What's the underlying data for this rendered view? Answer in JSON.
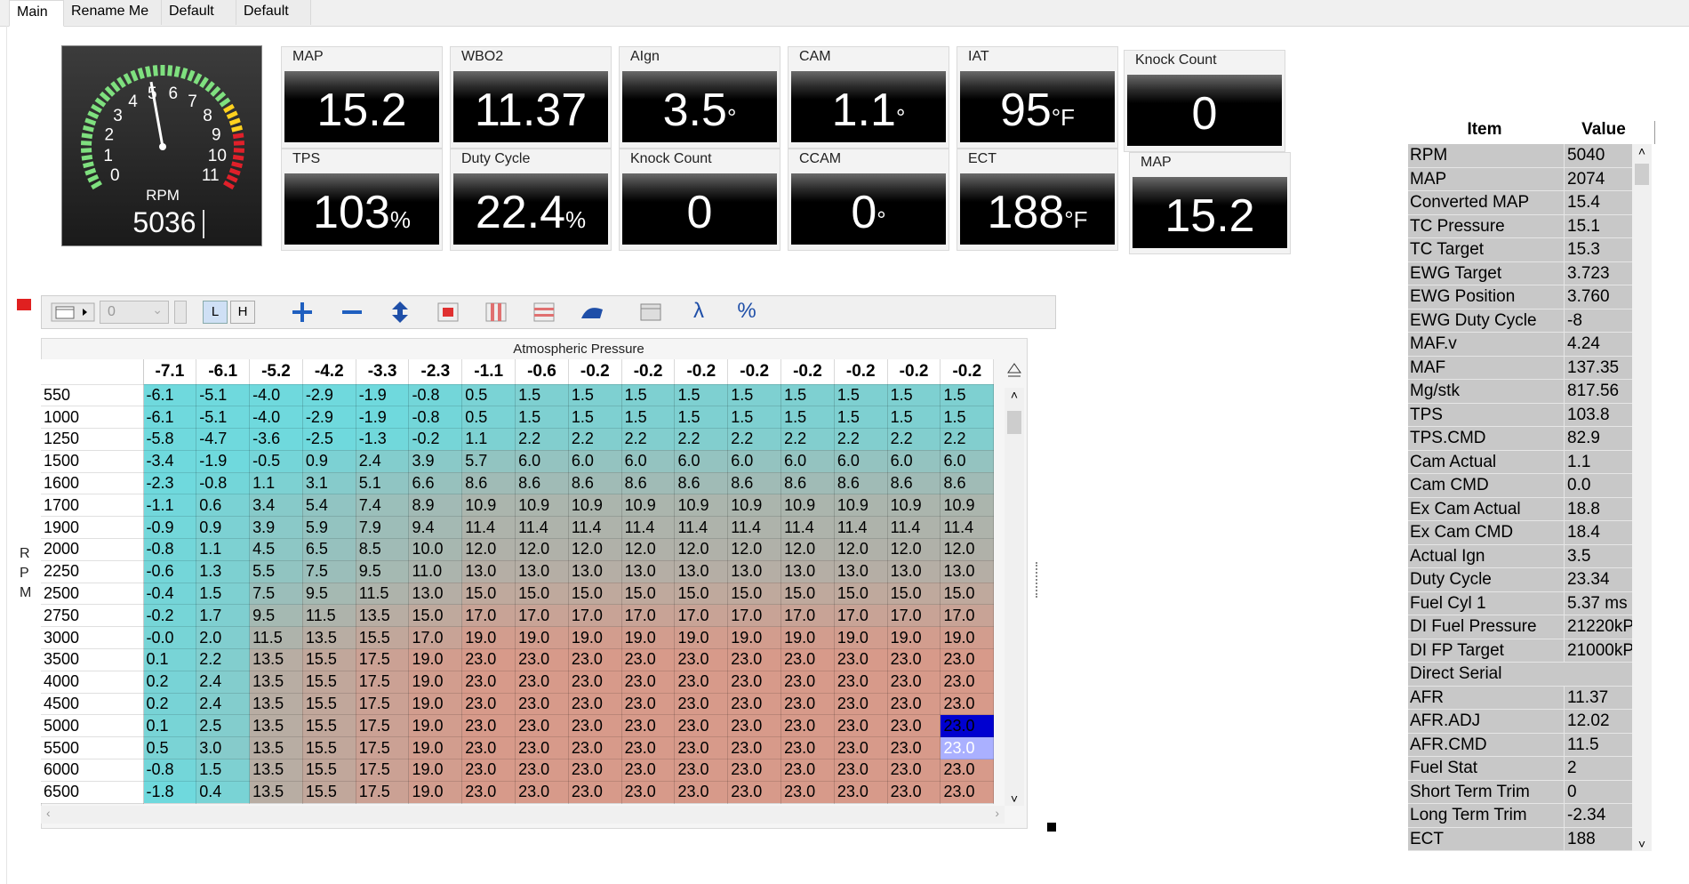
{
  "tabs": [
    "Main",
    "Rename Me",
    "Default",
    "Default"
  ],
  "gauge": {
    "label": "RPM",
    "value": "5036",
    "ticks": [
      "0",
      "1",
      "2",
      "3",
      "4",
      "5",
      "6",
      "7",
      "8",
      "9",
      "10",
      "11"
    ]
  },
  "tiles": [
    {
      "label": "MAP",
      "value": "15.2",
      "unit": ""
    },
    {
      "label": "WBO2",
      "value": "11.37",
      "unit": ""
    },
    {
      "label": "AIgn",
      "value": "3.5",
      "unit": "°"
    },
    {
      "label": "CAM",
      "value": "1.1",
      "unit": "°"
    },
    {
      "label": "IAT",
      "value": "95",
      "unit": "°F"
    },
    {
      "label": "Knock Count",
      "value": "0",
      "unit": ""
    },
    {
      "label": "TPS",
      "value": "103",
      "unit": "%"
    },
    {
      "label": "Duty Cycle",
      "value": "22.4",
      "unit": "%"
    },
    {
      "label": "Knock Count",
      "value": "0",
      "unit": ""
    },
    {
      "label": "CCAM",
      "value": "0",
      "unit": "°"
    },
    {
      "label": "ECT",
      "value": "188",
      "unit": "°F"
    },
    {
      "label": "MAP",
      "value": "15.2",
      "unit": ""
    }
  ],
  "toolbar": {
    "index_value": "0",
    "low_label": "L",
    "high_label": "H",
    "lambda_label": "λ",
    "percent_label": "%"
  },
  "table": {
    "x_axis_title": "Atmospheric Pressure",
    "y_axis_title": "RPM",
    "columns": [
      "-7.1",
      "-6.1",
      "-5.2",
      "-4.2",
      "-3.3",
      "-2.3",
      "-1.1",
      "-0.6",
      "-0.2",
      "-0.2",
      "-0.2",
      "-0.2",
      "-0.2",
      "-0.2",
      "-0.2",
      "-0.2"
    ],
    "rows": [
      {
        "rpm": "550",
        "values": [
          "-6.1",
          "-5.1",
          "-4.0",
          "-2.9",
          "-1.9",
          "-0.8",
          "0.5",
          "1.5",
          "1.5",
          "1.5",
          "1.5",
          "1.5",
          "1.5",
          "1.5",
          "1.5",
          "1.5"
        ]
      },
      {
        "rpm": "1000",
        "values": [
          "-6.1",
          "-5.1",
          "-4.0",
          "-2.9",
          "-1.9",
          "-0.8",
          "0.5",
          "1.5",
          "1.5",
          "1.5",
          "1.5",
          "1.5",
          "1.5",
          "1.5",
          "1.5",
          "1.5"
        ]
      },
      {
        "rpm": "1250",
        "values": [
          "-5.8",
          "-4.7",
          "-3.6",
          "-2.5",
          "-1.3",
          "-0.2",
          "1.1",
          "2.2",
          "2.2",
          "2.2",
          "2.2",
          "2.2",
          "2.2",
          "2.2",
          "2.2",
          "2.2"
        ]
      },
      {
        "rpm": "1500",
        "values": [
          "-3.4",
          "-1.9",
          "-0.5",
          "0.9",
          "2.4",
          "3.9",
          "5.7",
          "6.0",
          "6.0",
          "6.0",
          "6.0",
          "6.0",
          "6.0",
          "6.0",
          "6.0",
          "6.0"
        ]
      },
      {
        "rpm": "1600",
        "values": [
          "-2.3",
          "-0.8",
          "1.1",
          "3.1",
          "5.1",
          "6.6",
          "8.6",
          "8.6",
          "8.6",
          "8.6",
          "8.6",
          "8.6",
          "8.6",
          "8.6",
          "8.6",
          "8.6"
        ]
      },
      {
        "rpm": "1700",
        "values": [
          "-1.1",
          "0.6",
          "3.4",
          "5.4",
          "7.4",
          "8.9",
          "10.9",
          "10.9",
          "10.9",
          "10.9",
          "10.9",
          "10.9",
          "10.9",
          "10.9",
          "10.9",
          "10.9"
        ]
      },
      {
        "rpm": "1900",
        "values": [
          "-0.9",
          "0.9",
          "3.9",
          "5.9",
          "7.9",
          "9.4",
          "11.4",
          "11.4",
          "11.4",
          "11.4",
          "11.4",
          "11.4",
          "11.4",
          "11.4",
          "11.4",
          "11.4"
        ]
      },
      {
        "rpm": "2000",
        "values": [
          "-0.8",
          "1.1",
          "4.5",
          "6.5",
          "8.5",
          "10.0",
          "12.0",
          "12.0",
          "12.0",
          "12.0",
          "12.0",
          "12.0",
          "12.0",
          "12.0",
          "12.0",
          "12.0"
        ]
      },
      {
        "rpm": "2250",
        "values": [
          "-0.6",
          "1.3",
          "5.5",
          "7.5",
          "9.5",
          "11.0",
          "13.0",
          "13.0",
          "13.0",
          "13.0",
          "13.0",
          "13.0",
          "13.0",
          "13.0",
          "13.0",
          "13.0"
        ]
      },
      {
        "rpm": "2500",
        "values": [
          "-0.4",
          "1.5",
          "7.5",
          "9.5",
          "11.5",
          "13.0",
          "15.0",
          "15.0",
          "15.0",
          "15.0",
          "15.0",
          "15.0",
          "15.0",
          "15.0",
          "15.0",
          "15.0"
        ]
      },
      {
        "rpm": "2750",
        "values": [
          "-0.2",
          "1.7",
          "9.5",
          "11.5",
          "13.5",
          "15.0",
          "17.0",
          "17.0",
          "17.0",
          "17.0",
          "17.0",
          "17.0",
          "17.0",
          "17.0",
          "17.0",
          "17.0"
        ]
      },
      {
        "rpm": "3000",
        "values": [
          "-0.0",
          "2.0",
          "11.5",
          "13.5",
          "15.5",
          "17.0",
          "19.0",
          "19.0",
          "19.0",
          "19.0",
          "19.0",
          "19.0",
          "19.0",
          "19.0",
          "19.0",
          "19.0"
        ]
      },
      {
        "rpm": "3500",
        "values": [
          "0.1",
          "2.2",
          "13.5",
          "15.5",
          "17.5",
          "19.0",
          "23.0",
          "23.0",
          "23.0",
          "23.0",
          "23.0",
          "23.0",
          "23.0",
          "23.0",
          "23.0",
          "23.0"
        ]
      },
      {
        "rpm": "4000",
        "values": [
          "0.2",
          "2.4",
          "13.5",
          "15.5",
          "17.5",
          "19.0",
          "23.0",
          "23.0",
          "23.0",
          "23.0",
          "23.0",
          "23.0",
          "23.0",
          "23.0",
          "23.0",
          "23.0"
        ]
      },
      {
        "rpm": "4500",
        "values": [
          "0.2",
          "2.4",
          "13.5",
          "15.5",
          "17.5",
          "19.0",
          "23.0",
          "23.0",
          "23.0",
          "23.0",
          "23.0",
          "23.0",
          "23.0",
          "23.0",
          "23.0",
          "23.0"
        ]
      },
      {
        "rpm": "5000",
        "values": [
          "0.1",
          "2.5",
          "13.5",
          "15.5",
          "17.5",
          "19.0",
          "23.0",
          "23.0",
          "23.0",
          "23.0",
          "23.0",
          "23.0",
          "23.0",
          "23.0",
          "23.0",
          "23.0"
        ]
      },
      {
        "rpm": "5500",
        "values": [
          "0.5",
          "3.0",
          "13.5",
          "15.5",
          "17.5",
          "19.0",
          "23.0",
          "23.0",
          "23.0",
          "23.0",
          "23.0",
          "23.0",
          "23.0",
          "23.0",
          "23.0",
          "23.0"
        ]
      },
      {
        "rpm": "6000",
        "values": [
          "-0.8",
          "1.5",
          "13.5",
          "15.5",
          "17.5",
          "19.0",
          "23.0",
          "23.0",
          "23.0",
          "23.0",
          "23.0",
          "23.0",
          "23.0",
          "23.0",
          "23.0",
          "23.0"
        ]
      },
      {
        "rpm": "6500",
        "values": [
          "-1.8",
          "0.4",
          "13.5",
          "15.5",
          "17.5",
          "19.0",
          "23.0",
          "23.0",
          "23.0",
          "23.0",
          "23.0",
          "23.0",
          "23.0",
          "23.0",
          "23.0",
          "23.0"
        ]
      }
    ],
    "selected_cell": {
      "row": 15,
      "col": 15
    },
    "trace_cell": {
      "row": 16,
      "col": 15
    },
    "colors": {
      "low": "#6fd9dd",
      "high": "#d79a8a",
      "selected": "#0000d0",
      "trace": "#aab0ff"
    }
  },
  "datalog": {
    "headers": {
      "item": "Item",
      "value": "Value"
    },
    "rows": [
      {
        "item": "RPM",
        "value": "5040"
      },
      {
        "item": "MAP",
        "value": "2074"
      },
      {
        "item": "Converted MAP",
        "value": "15.4"
      },
      {
        "item": "TC Pressure",
        "value": "15.1"
      },
      {
        "item": "TC Target",
        "value": "15.3"
      },
      {
        "item": "EWG Target",
        "value": "3.723"
      },
      {
        "item": "EWG Position",
        "value": "3.760"
      },
      {
        "item": "EWG Duty Cycle",
        "value": "-8"
      },
      {
        "item": "MAF.v",
        "value": "4.24"
      },
      {
        "item": "MAF",
        "value": "137.35"
      },
      {
        "item": "Mg/stk",
        "value": "817.56"
      },
      {
        "item": "TPS",
        "value": "103.8"
      },
      {
        "item": "TPS.CMD",
        "value": "82.9"
      },
      {
        "item": "Cam Actual",
        "value": "1.1"
      },
      {
        "item": "Cam CMD",
        "value": "0.0"
      },
      {
        "item": "Ex Cam Actual",
        "value": "18.8"
      },
      {
        "item": "Ex Cam CMD",
        "value": "18.4"
      },
      {
        "item": "Actual Ign",
        "value": "3.5"
      },
      {
        "item": "Duty Cycle",
        "value": "23.34"
      },
      {
        "item": "Fuel Cyl 1",
        "value": "5.37 ms"
      },
      {
        "item": "DI Fuel Pressure",
        "value": "21220kP"
      },
      {
        "item": "DI FP Target",
        "value": "21000kP"
      },
      {
        "item": "Direct Serial",
        "value": ""
      },
      {
        "item": "AFR",
        "value": "11.37"
      },
      {
        "item": "AFR.ADJ",
        "value": "12.02"
      },
      {
        "item": "AFR.CMD",
        "value": "11.5"
      },
      {
        "item": "Fuel Stat",
        "value": "2"
      },
      {
        "item": "Short Term Trim",
        "value": "0"
      },
      {
        "item": "Long Term Trim",
        "value": "-2.34"
      },
      {
        "item": "ECT",
        "value": "188"
      }
    ]
  }
}
